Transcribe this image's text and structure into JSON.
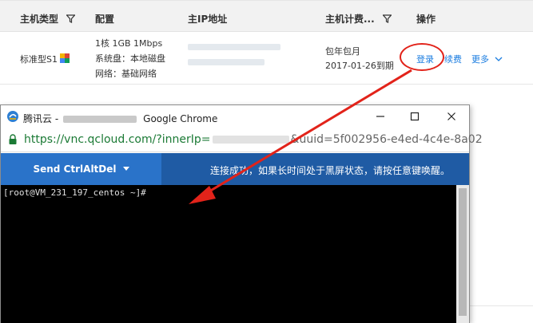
{
  "table": {
    "headers": {
      "type": "主机类型",
      "config": "配置",
      "ip": "主IP地址",
      "billing": "主机计费...",
      "ops": "操作"
    },
    "row": {
      "type": "标准型S1",
      "config": [
        "1核 1GB 1Mbps",
        "系统盘：本地磁盘",
        "网络：基础网络"
      ],
      "billing_mode": "包年包月",
      "expiry": "2017-01-26到期",
      "login": "登录",
      "renew": "续费",
      "more": "更多"
    }
  },
  "window": {
    "title_prefix": "腾讯云 -",
    "title_suffix": "Google Chrome",
    "url_host": "https://vnc.qcloud.com/?innerIp=",
    "url_rest": "&uuid=5f002956-e4ed-4c4e-8a02"
  },
  "vnc": {
    "send_button": "Send CtrlAltDel",
    "status": "连接成功，如果长时间处于黑屏状态，请按任意键唤醒。"
  },
  "terminal": {
    "prompt": "[root@VM_231_197_centos ~]#"
  },
  "colors": {
    "link": "#1b7de0",
    "annotation_red": "#e2231a",
    "vnc_toolbar": "#1f5ba4",
    "vnc_button": "#2a73c9",
    "url_green": "#1b7a35"
  },
  "icons": {
    "filter": "filter-icon",
    "badge": "product-badge-icon",
    "lock": "lock-icon",
    "app": "tencent-cloud-icon"
  }
}
